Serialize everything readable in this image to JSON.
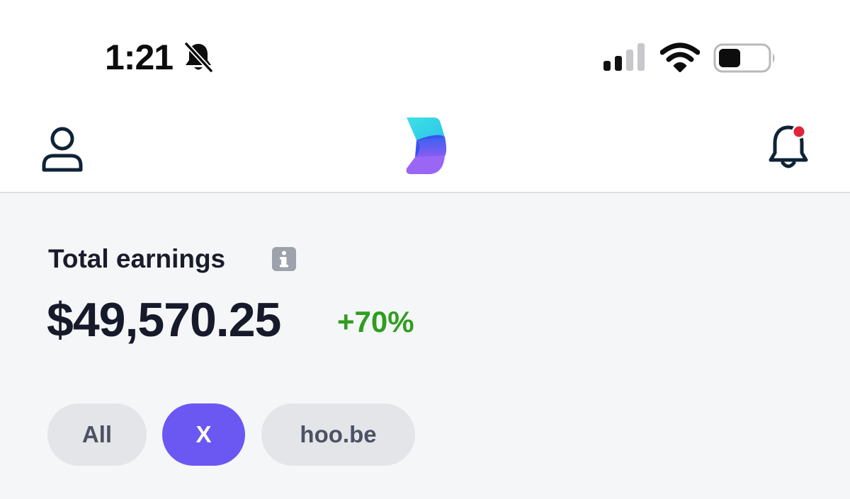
{
  "status_bar": {
    "time": "1:21",
    "icons": [
      "bell-slash-icon",
      "cellular-signal-icon",
      "wifi-icon",
      "battery-icon"
    ]
  },
  "header": {
    "icons": [
      "user-profile-icon",
      "app-logo",
      "bell-icon"
    ],
    "notification_dot_color": "#e0243a"
  },
  "earnings": {
    "label": "Total earnings",
    "amount": "$49,570.25",
    "change": "+70%",
    "change_color": "#2f9e1f"
  },
  "filters": {
    "items": [
      {
        "label": "All",
        "active": false
      },
      {
        "label": "X",
        "active": true
      },
      {
        "label": "hoo.be",
        "active": false
      }
    ],
    "accent_color": "#6b57f2"
  }
}
